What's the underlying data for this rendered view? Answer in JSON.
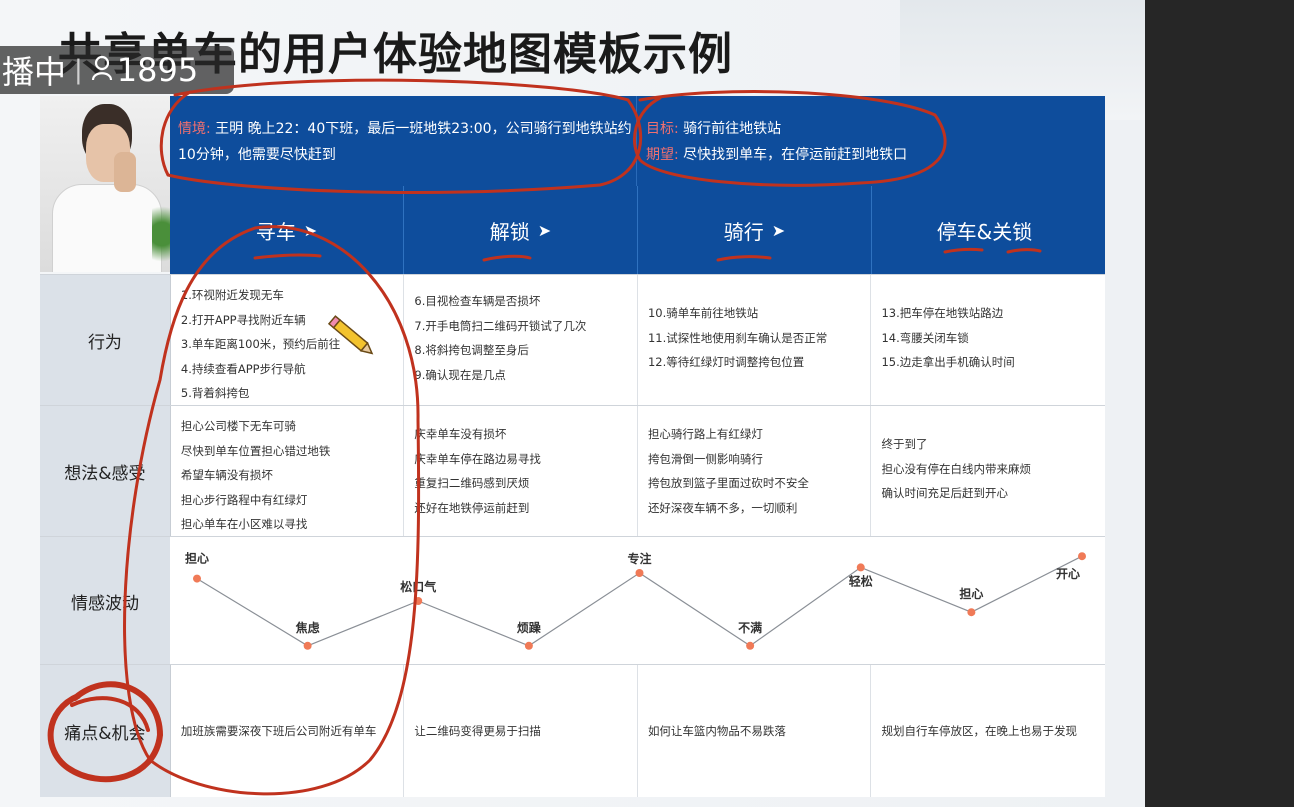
{
  "title": "共享单车的用户体验地图模板示例",
  "live_badge": {
    "text": "播中",
    "separator": "|",
    "viewer_icon": "person-icon",
    "viewer_count": "1895"
  },
  "header": {
    "scenario_label": "情境:",
    "scenario_text_line1": " 王明   晚上22：40下班，最后一班地铁23:00，公司骑行到地铁站约",
    "scenario_text_line2": "10分钟，他需要尽快赶到",
    "goal_label": "目标:",
    "goal_text": " 骑行前往地铁站",
    "expect_label": "期望:",
    "expect_text": " 尽快找到单车，在停运前赶到地铁口"
  },
  "stages": [
    {
      "label": "寻车",
      "arrow": "➤"
    },
    {
      "label": "解锁",
      "arrow": "➤"
    },
    {
      "label": "骑行",
      "arrow": "➤"
    },
    {
      "label": "停车&关锁",
      "arrow": ""
    }
  ],
  "rows": {
    "behavior": {
      "label": "行为",
      "cells": [
        [
          "1.环视附近发现无车",
          "2.打开APP寻找附近车辆",
          "3.单车距离100米，预约后前往",
          "4.持续查看APP步行导航",
          "5.背着斜挎包"
        ],
        [
          "6.目视检查车辆是否损坏",
          "7.开手电筒扫二维码开锁试了几次",
          "8.将斜挎包调整至身后",
          "9.确认现在是几点"
        ],
        [
          "10.骑单车前往地铁站",
          "11.试探性地使用刹车确认是否正常",
          "12.等待红绿灯时调整挎包位置"
        ],
        [
          "13.把车停在地铁站路边",
          "14.弯腰关闭车锁",
          "15.边走拿出手机确认时间"
        ]
      ]
    },
    "thoughts": {
      "label": "想法&感受",
      "cells": [
        [
          "担心公司楼下无车可骑",
          "尽快到单车位置担心错过地铁",
          "希望车辆没有损坏",
          "担心步行路程中有红绿灯",
          "担心单车在小区难以寻找"
        ],
        [
          "庆幸单车没有损坏",
          "庆幸单车停在路边易寻找",
          "重复扫二维码感到厌烦",
          "还好在地铁停运前赶到"
        ],
        [
          "担心骑行路上有红绿灯",
          "挎包滑倒一侧影响骑行",
          "挎包放到篮子里面过砍时不安全",
          "还好深夜车辆不多，一切顺利"
        ],
        [
          "终于到了",
          "担心没有停在白线内带来麻烦",
          "确认时间充足后赶到开心"
        ]
      ]
    },
    "emotion": {
      "label": "情感波动"
    },
    "pain": {
      "label": "痛点&机会",
      "cells": [
        "加班族需要深夜下班后公司附近有单车",
        "让二维码变得更易于扫描",
        "如何让车篮内物品不易跌落",
        "规划自行车停放区，在晚上也易于发现"
      ]
    }
  },
  "chart_data": {
    "type": "line",
    "title": "",
    "xlabel": "",
    "ylabel": "",
    "ylim": [
      0,
      10
    ],
    "series": [
      {
        "name": "",
        "color": "#f07a57",
        "points": [
          {
            "label": "担心",
            "x": 1,
            "y": 7
          },
          {
            "label": "焦虑",
            "x": 2,
            "y": 1
          },
          {
            "label": "松口气",
            "x": 3,
            "y": 5
          },
          {
            "label": "烦躁",
            "x": 4,
            "y": 1
          },
          {
            "label": "专注",
            "x": 5,
            "y": 7.5
          },
          {
            "label": "不满",
            "x": 6,
            "y": 1
          },
          {
            "label": "轻松",
            "x": 7,
            "y": 8
          },
          {
            "label": "担心",
            "x": 8,
            "y": 4
          },
          {
            "label": "开心",
            "x": 9,
            "y": 9
          }
        ]
      }
    ]
  },
  "colors": {
    "header_blue": "#0e4d9c",
    "ink_red": "#c0321e",
    "row_label_bg": "#dbe1e8",
    "point_orange": "#f07a57"
  }
}
